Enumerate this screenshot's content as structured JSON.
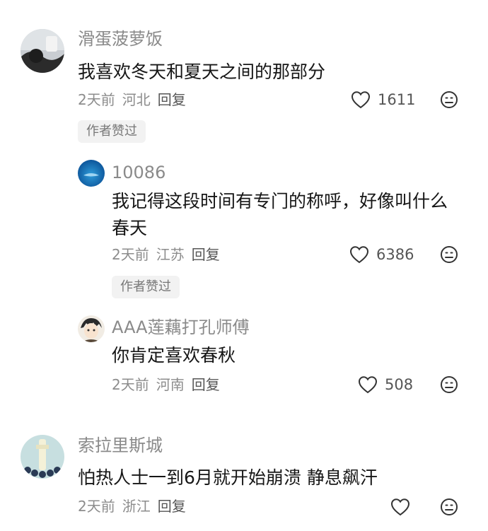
{
  "comments": [
    {
      "username": "滑蛋菠萝饭",
      "content": "我喜欢冬天和夏天之间的那部分",
      "time": "2天前",
      "location": "河北",
      "reply_label": "回复",
      "likes": "1611",
      "badge": "作者赞过"
    },
    {
      "username": "10086",
      "content": "我记得这段时间有专门的称呼，好像叫什么春天",
      "time": "2天前",
      "location": "江苏",
      "reply_label": "回复",
      "likes": "6386",
      "badge": "作者赞过"
    },
    {
      "username": "AAA莲藕打孔师傅",
      "content": "你肯定喜欢春秋",
      "time": "2天前",
      "location": "河南",
      "reply_label": "回复",
      "likes": "508"
    },
    {
      "username": "索拉里斯城",
      "content": "怕热人士一到6月就开始崩溃 静息飙汗",
      "time": "2天前",
      "location": "浙江",
      "reply_label": "回复"
    }
  ],
  "icons": {
    "like": "heart-outline-icon",
    "dislike": "frown-face-icon"
  },
  "colors": {
    "username": "#8a8a8a",
    "text": "#161616",
    "badge_bg": "#f2f2f2"
  }
}
